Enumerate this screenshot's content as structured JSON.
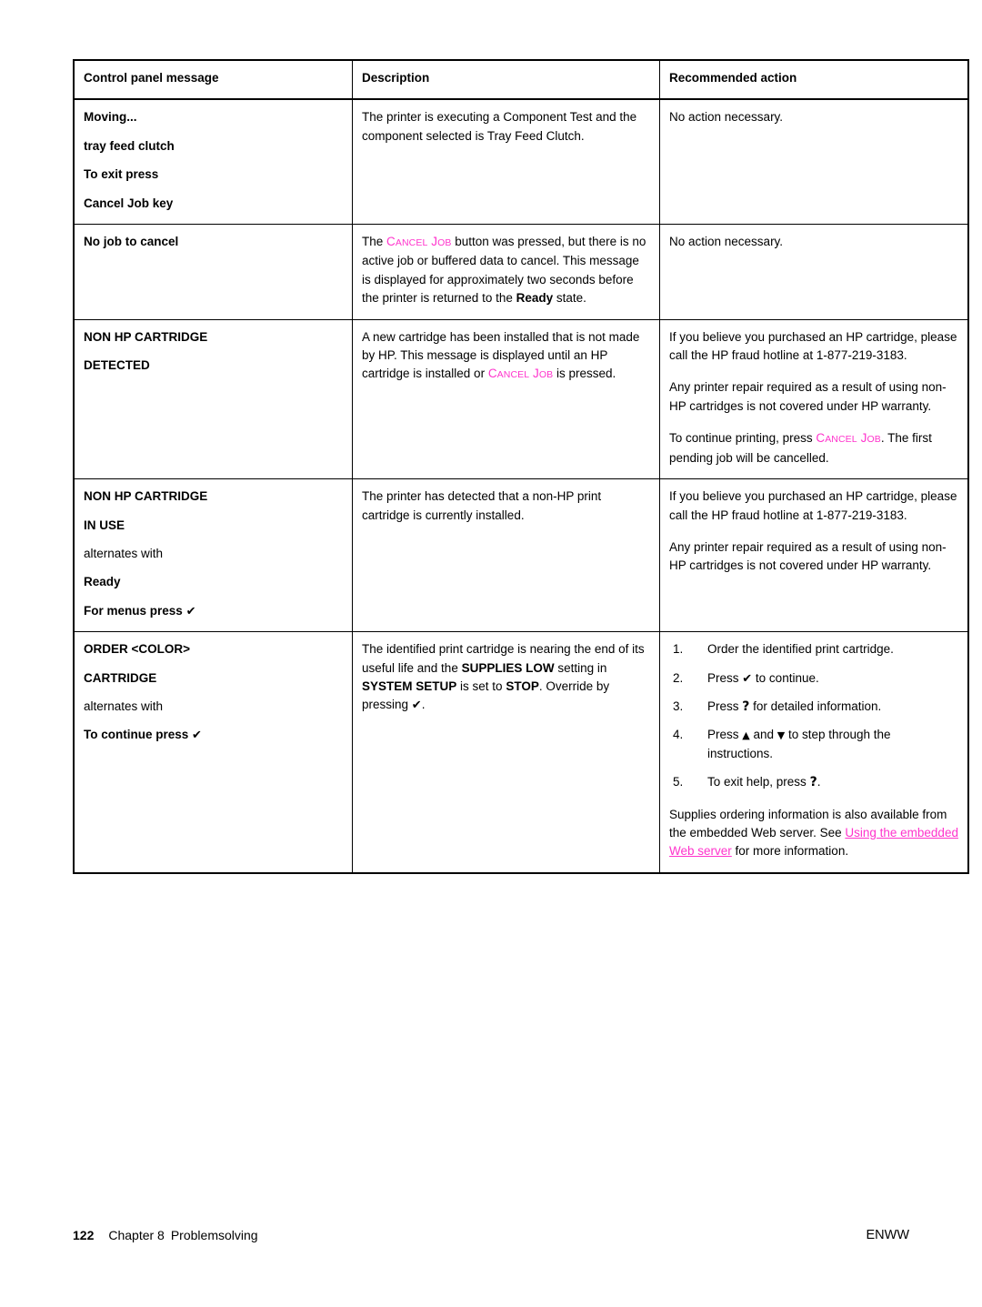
{
  "document": {
    "table": {
      "headers": [
        "Control panel message",
        "Description",
        "Recommended action"
      ],
      "rows": [
        {
          "id": "moving-tray-feed-clutch",
          "message_lines": [
            "Moving...",
            "tray feed clutch",
            "To exit press",
            "Cancel Job key"
          ],
          "description": "The printer is executing a Component Test and the component selected is Tray Feed Clutch.",
          "action": "No action necessary."
        },
        {
          "id": "no-job-to-cancel",
          "message_lines": [
            "No job to cancel"
          ],
          "description_pre": "The ",
          "description_key": "Cancel Job",
          "description_mid": " button was pressed, but there is no active job or buffered data to cancel. This message is displayed for approximately two seconds before the printer is returned to the ",
          "description_bold": "Ready",
          "description_post": " state.",
          "action": "No action necessary."
        },
        {
          "id": "non-hp-cartridge-detected",
          "message_lines": [
            "NON HP CARTRIDGE",
            "DETECTED"
          ],
          "description_pre": "A new cartridge has been installed that is not made by HP. This message is displayed until an HP cartridge is installed or ",
          "description_key": "Cancel Job",
          "description_post": " is pressed.",
          "action_p1": "If you believe you purchased an HP cartridge, please call the HP fraud hotline at 1-877-219-3183.",
          "action_p2": "Any printer repair required as a result of using non-HP cartridges is not covered under HP warranty.",
          "action_p3_pre": "To continue printing, press ",
          "action_p3_key": "Cancel Job",
          "action_p3_post": ". The first pending job will be cancelled."
        },
        {
          "id": "non-hp-cartridge-in-use",
          "message_lines": [
            "NON HP CARTRIDGE",
            "IN USE"
          ],
          "alternates_label": "alternates with",
          "message_lines2": [
            "Ready",
            "For menus press"
          ],
          "description": "The printer has detected that a non-HP print cartridge is currently installed.",
          "action_p1": "If you believe you purchased an HP cartridge, please call the HP fraud hotline at 1-877-219-3183.",
          "action_p2": "Any printer repair required as a result of using non-HP cartridges is not covered under HP warranty."
        },
        {
          "id": "order-color-cartridge",
          "message_lines": [
            "ORDER <COLOR>",
            "CARTRIDGE"
          ],
          "alternates_label": "alternates with",
          "message_lines2": [
            "To continue press"
          ],
          "description_pre": "The identified print cartridge is nearing the end of its useful life and the ",
          "description_b1": "SUPPLIES LOW",
          "description_m1": " setting in ",
          "description_b2": "SYSTEM SETUP",
          "description_m2": " is set to ",
          "description_b3": "STOP",
          "description_post": ". Override by pressing ",
          "description_end": ".",
          "steps": [
            {
              "num": "1.",
              "pre": "Order the identified print cartridge.",
              "glyph": "",
              "post": ""
            },
            {
              "num": "2.",
              "pre": "Press ",
              "glyph": "check",
              "post": " to continue."
            },
            {
              "num": "3.",
              "pre": "Press ",
              "glyph": "question",
              "post": " for detailed information."
            },
            {
              "num": "4.",
              "pre": "Press ",
              "glyph": "up-down",
              "post": " to step through the instructions."
            },
            {
              "num": "5.",
              "pre": "To exit help, press ",
              "glyph": "question",
              "post": "."
            }
          ],
          "note_pre": "Supplies ordering information is also available from the embedded Web server. See ",
          "note_link": "Using the embedded Web server",
          "note_post": " for more information.",
          "step4_and": " and "
        }
      ]
    },
    "footer": {
      "page_number": "122",
      "chapter_label": "Chapter 8",
      "chapter_title": "Problemsolving",
      "right": "ENWW"
    },
    "glyphs": {
      "check": "✔",
      "question": "?",
      "up": "▲",
      "down": "▼"
    },
    "colors": {
      "link": "#ff33cc",
      "key": "#ff33cc",
      "text": "#000000",
      "border": "#000000"
    }
  }
}
